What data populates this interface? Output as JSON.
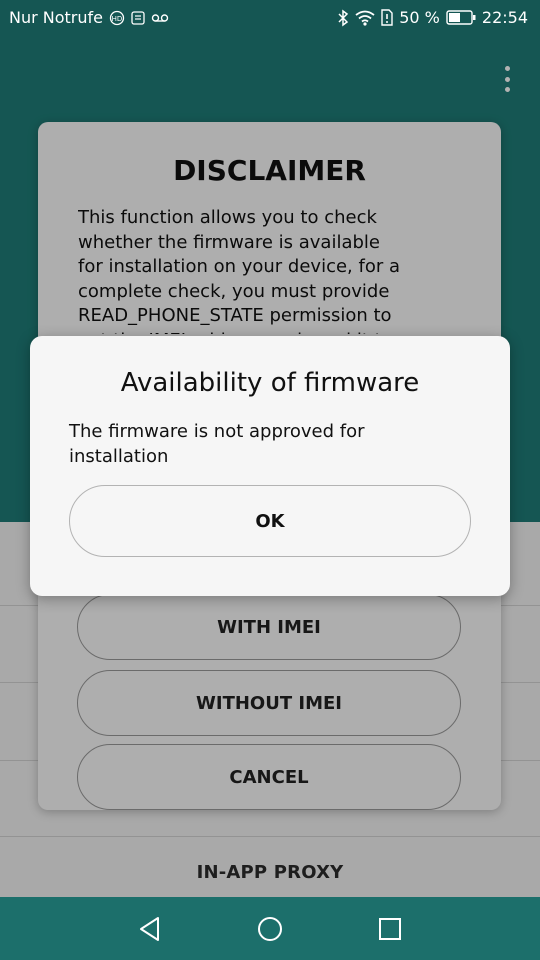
{
  "status_bar": {
    "carrier": "Nur Notrufe",
    "battery_percent": "50 %",
    "time": "22:54",
    "icons": [
      "hd-icon",
      "message-icon",
      "voicemail-icon",
      "bluetooth-icon",
      "wifi-icon",
      "sim-alert-icon",
      "battery-icon"
    ]
  },
  "disclaimer": {
    "title": "DISCLAIMER",
    "body": "This function allows you to check\nwhether the firmware is available\nfor installation on your device, for a\ncomplete check, you must provide\nREAD_PHONE_STATE permission to\nget the IMEI address and send it to our",
    "buttons": {
      "with_imei": "WITH IMEI",
      "without_imei": "WITHOUT IMEI",
      "cancel": "CANCEL"
    }
  },
  "firmware_dialog": {
    "title": "Availability of firmware",
    "message": "The firmware is not approved for installation",
    "ok_label": "OK"
  },
  "background_list": {
    "proxy_label": "IN-APP PROXY"
  },
  "nav_bar": {
    "icons": [
      "back-icon",
      "home-icon",
      "recents-icon"
    ]
  },
  "colors": {
    "app_bar": "#1f7c77",
    "nav_bar": "#1c6f6b",
    "dialog_bg": "#f6f6f6"
  }
}
